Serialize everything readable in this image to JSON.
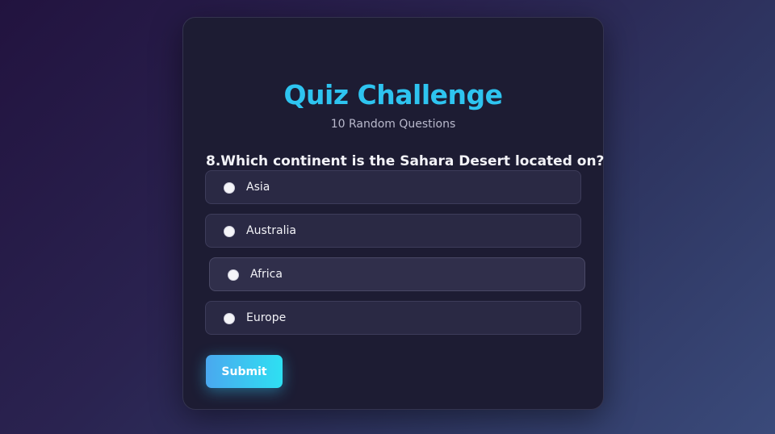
{
  "quiz": {
    "title": "Quiz Challenge",
    "subtitle": "10 Random Questions",
    "question": "8.Which continent is the Sahara Desert located on?",
    "options": [
      {
        "label": "Asia"
      },
      {
        "label": "Australia"
      },
      {
        "label": "Africa"
      },
      {
        "label": "Europe"
      }
    ],
    "submit_label": "Submit"
  },
  "colors": {
    "title": "#2ec4f0",
    "submit_start": "#4aa8ef",
    "submit_end": "#2ee0f2",
    "card_background": "#1d1c33",
    "option_background": "#2a2944"
  }
}
